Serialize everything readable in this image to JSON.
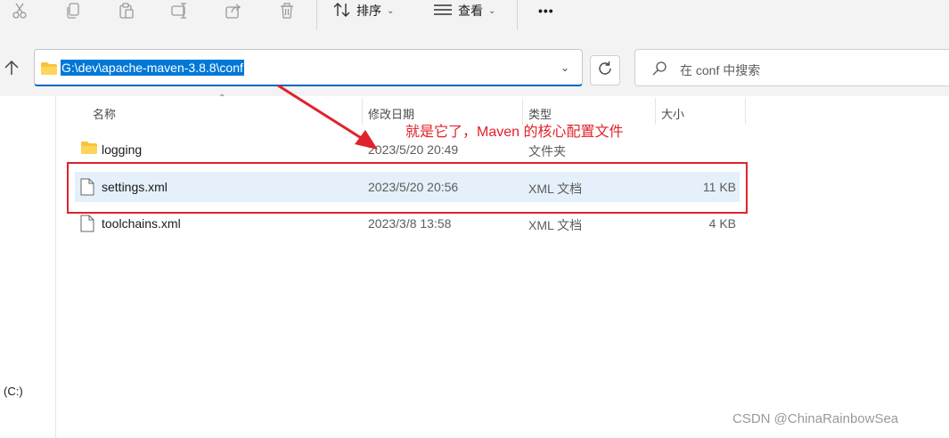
{
  "toolbar": {
    "icons": [
      "cut-icon",
      "copy-icon",
      "paste-icon",
      "rename-icon",
      "share-icon",
      "delete-icon"
    ],
    "sort_label": "排序",
    "view_label": "查看",
    "more_label": "•••"
  },
  "address": {
    "path": "G:\\dev\\apache-maven-3.8.8\\conf"
  },
  "search": {
    "placeholder": "在 conf 中搜索"
  },
  "columns": {
    "name": "名称",
    "modified": "修改日期",
    "type": "类型",
    "size": "大小"
  },
  "files": [
    {
      "name": "logging",
      "modified": "2023/5/20 20:49",
      "type": "文件夹",
      "size": "",
      "icon": "folder-icon"
    },
    {
      "name": "settings.xml",
      "modified": "2023/5/20 20:56",
      "type": "XML 文档",
      "size": "11 KB",
      "icon": "file-icon"
    },
    {
      "name": "toolchains.xml",
      "modified": "2023/3/8 13:58",
      "type": "XML 文档",
      "size": "4 KB",
      "icon": "file-icon"
    }
  ],
  "annotation": "就是它了，Maven 的核心配置文件",
  "nav": {
    "drive_label": "(C:)"
  },
  "watermark": "CSDN @ChinaRainbowSea",
  "colors": {
    "accent": "#0078d7",
    "highlight_row": "#e5f0fb",
    "annotation_red": "#e0222a"
  }
}
